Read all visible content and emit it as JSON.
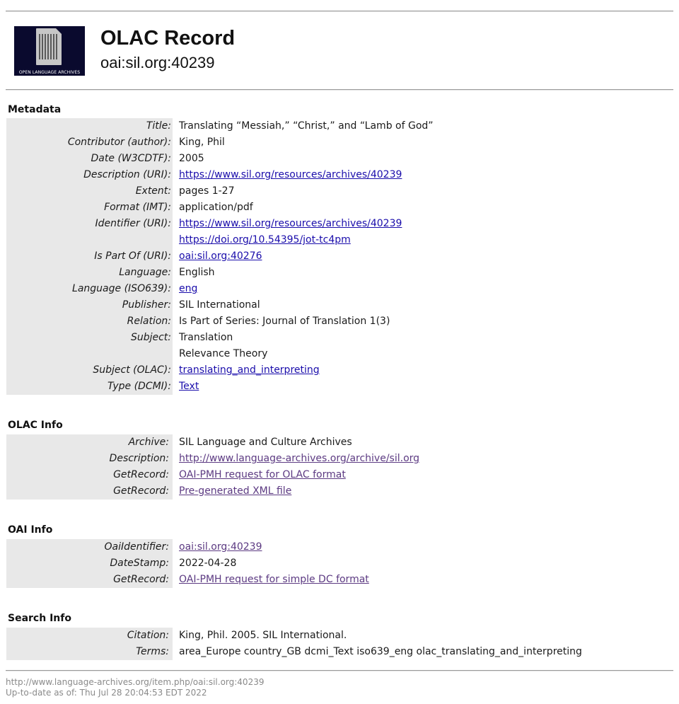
{
  "header": {
    "logo_text": "OPEN LANGUAGE ARCHIVES",
    "title": "OLAC Record",
    "subtitle": "oai:sil.org:40239"
  },
  "metadata": {
    "heading": "Metadata",
    "rows": [
      {
        "label": "Title:",
        "values": [
          {
            "text": "Translating “Messiah,” “Christ,” and “Lamb of God”",
            "link": false
          }
        ]
      },
      {
        "label": "Contributor (author):",
        "values": [
          {
            "text": "King, Phil",
            "link": false
          }
        ]
      },
      {
        "label": "Date (W3CDTF):",
        "values": [
          {
            "text": "2005",
            "link": false
          }
        ]
      },
      {
        "label": "Description (URI):",
        "values": [
          {
            "text": "https://www.sil.org/resources/archives/40239",
            "link": true
          }
        ]
      },
      {
        "label": "Extent:",
        "values": [
          {
            "text": "pages 1-27",
            "link": false
          }
        ]
      },
      {
        "label": "Format (IMT):",
        "values": [
          {
            "text": "application/pdf",
            "link": false
          }
        ]
      },
      {
        "label": "Identifier (URI):",
        "values": [
          {
            "text": "https://www.sil.org/resources/archives/40239",
            "link": true
          },
          {
            "text": "https://doi.org/10.54395/jot-tc4pm",
            "link": true
          }
        ]
      },
      {
        "label": "Is Part Of (URI):",
        "values": [
          {
            "text": "oai:sil.org:40276",
            "link": true
          }
        ]
      },
      {
        "label": "Language:",
        "values": [
          {
            "text": "English",
            "link": false
          }
        ]
      },
      {
        "label": "Language (ISO639):",
        "values": [
          {
            "text": "eng",
            "link": true
          }
        ]
      },
      {
        "label": "Publisher:",
        "values": [
          {
            "text": "SIL International",
            "link": false
          }
        ]
      },
      {
        "label": "Relation:",
        "values": [
          {
            "text": "Is Part of Series: Journal of Translation 1(3)",
            "link": false
          }
        ]
      },
      {
        "label": "Subject:",
        "values": [
          {
            "text": "Translation",
            "link": false
          },
          {
            "text": "Relevance Theory",
            "link": false
          }
        ]
      },
      {
        "label": "Subject (OLAC):",
        "values": [
          {
            "text": "translating_and_interpreting",
            "link": true
          }
        ]
      },
      {
        "label": "Type (DCMI):",
        "values": [
          {
            "text": "Text",
            "link": true
          }
        ]
      }
    ]
  },
  "olac_info": {
    "heading": "OLAC Info",
    "rows": [
      {
        "label": "Archive:",
        "values": [
          {
            "text": "SIL Language and Culture Archives",
            "link": false
          }
        ]
      },
      {
        "label": "Description:",
        "values": [
          {
            "text": "http://www.language-archives.org/archive/sil.org",
            "link": true,
            "visited": true
          }
        ]
      },
      {
        "label": "GetRecord:",
        "values": [
          {
            "text": "OAI-PMH request for OLAC format",
            "link": true,
            "visited": true
          }
        ]
      },
      {
        "label": "GetRecord:",
        "values": [
          {
            "text": "Pre-generated XML file",
            "link": true,
            "visited": true
          }
        ]
      }
    ]
  },
  "oai_info": {
    "heading": "OAI Info",
    "rows": [
      {
        "label": "OaiIdentifier:",
        "values": [
          {
            "text": "oai:sil.org:40239",
            "link": true,
            "visited": true
          }
        ]
      },
      {
        "label": "DateStamp:",
        "values": [
          {
            "text": "2022-04-28",
            "link": false
          }
        ]
      },
      {
        "label": "GetRecord:",
        "values": [
          {
            "text": "OAI-PMH request for simple DC format",
            "link": true,
            "visited": true
          }
        ]
      }
    ]
  },
  "search_info": {
    "heading": "Search Info",
    "rows": [
      {
        "label": "Citation:",
        "values": [
          {
            "text": "King, Phil. 2005. SIL International.",
            "link": false
          }
        ]
      },
      {
        "label": "Terms:",
        "values": [
          {
            "text": "area_Europe country_GB dcmi_Text iso639_eng olac_translating_and_interpreting",
            "link": false
          }
        ]
      }
    ]
  },
  "footer": {
    "url": "http://www.language-archives.org/item.php/oai:sil.org:40239",
    "updated": "Up-to-date as of: Thu Jul 28 20:04:53 EDT 2022"
  },
  "colors": {
    "link": "#1a0dab",
    "visited_link": "#5c3a82",
    "label_bg": "#e8e8e8"
  }
}
